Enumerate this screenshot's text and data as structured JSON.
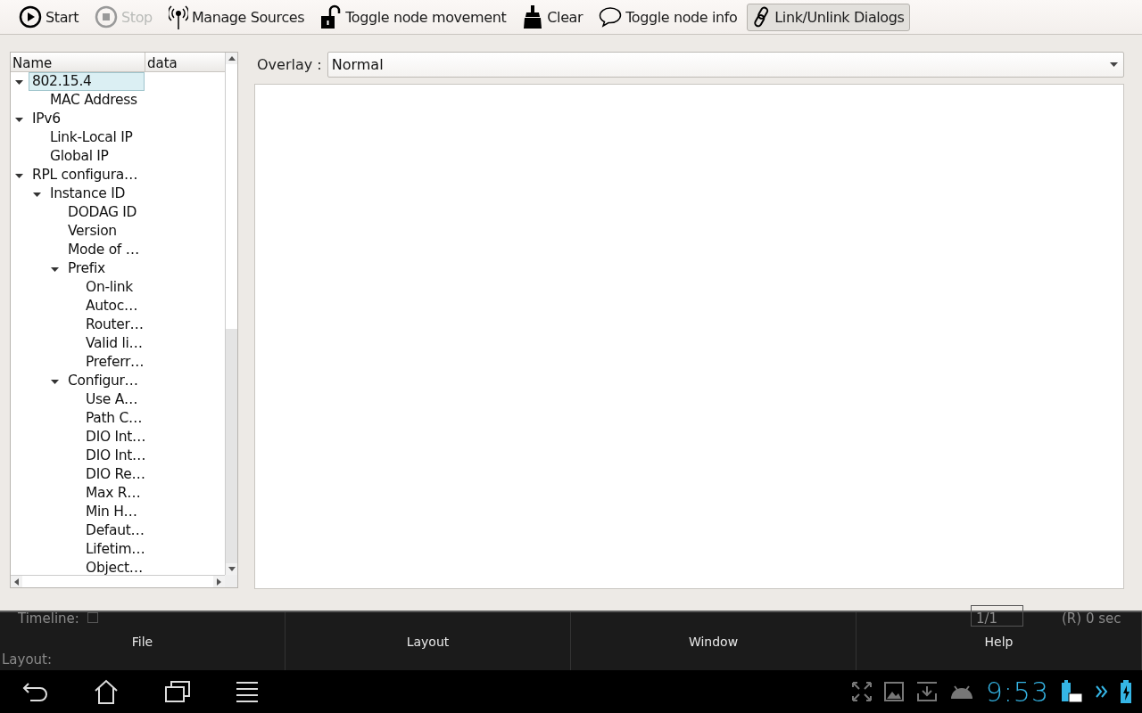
{
  "toolbar": [
    {
      "label": "Start",
      "disabled": false,
      "selected": false
    },
    {
      "label": "Stop",
      "disabled": true,
      "selected": false
    },
    {
      "label": "Manage Sources",
      "disabled": false,
      "selected": false
    },
    {
      "label": "Toggle node movement",
      "disabled": false,
      "selected": false
    },
    {
      "label": "Clear",
      "disabled": false,
      "selected": false
    },
    {
      "label": "Toggle node info",
      "disabled": false,
      "selected": false
    },
    {
      "label": "Link/Unlink Dialogs",
      "disabled": false,
      "selected": true
    }
  ],
  "tree": {
    "columns": [
      "Name",
      "data"
    ],
    "items": [
      {
        "label": "802.15.4",
        "selected": true,
        "expanded": true,
        "children": [
          {
            "label": "MAC Address",
            "selected": false
          }
        ]
      },
      {
        "label": "IPv6",
        "selected": false,
        "expanded": true,
        "children": [
          {
            "label": "Link-Local IP",
            "selected": false
          },
          {
            "label": "Global IP",
            "selected": false
          }
        ]
      },
      {
        "label": "RPL configura…",
        "selected": false,
        "expanded": true,
        "children": [
          {
            "label": "Instance ID",
            "selected": false,
            "expanded": true,
            "children": [
              {
                "label": "DODAG ID",
                "selected": false
              },
              {
                "label": "Version",
                "selected": false
              },
              {
                "label": "Mode of …",
                "selected": false
              },
              {
                "label": "Prefix",
                "selected": false,
                "expanded": true,
                "children": [
                  {
                    "label": "On-link",
                    "selected": false
                  },
                  {
                    "label": "Autoc…",
                    "selected": false
                  },
                  {
                    "label": "Router…",
                    "selected": false
                  },
                  {
                    "label": "Valid li…",
                    "selected": false
                  },
                  {
                    "label": "Preferr…",
                    "selected": false
                  }
                ]
              },
              {
                "label": "Configur…",
                "selected": false,
                "expanded": true,
                "children": [
                  {
                    "label": "Use A…",
                    "selected": false
                  },
                  {
                    "label": "Path C…",
                    "selected": false
                  },
                  {
                    "label": "DIO Int…",
                    "selected": false
                  },
                  {
                    "label": "DIO Int…",
                    "selected": false
                  },
                  {
                    "label": "DIO Re…",
                    "selected": false
                  },
                  {
                    "label": "Max R…",
                    "selected": false
                  },
                  {
                    "label": "Min H…",
                    "selected": false
                  },
                  {
                    "label": "Defaut…",
                    "selected": false
                  },
                  {
                    "label": "Lifetim…",
                    "selected": false
                  },
                  {
                    "label": "Object…",
                    "selected": false
                  }
                ]
              }
            ]
          }
        ]
      }
    ]
  },
  "overlay": {
    "label": "Overlay :",
    "value": "Normal"
  },
  "timeline": {
    "label": "Timeline:",
    "checked": false
  },
  "page_counter": "1/1",
  "elapsed": "(R) 0 sec",
  "layout_label": "Layout:",
  "menu": [
    {
      "label": "File"
    },
    {
      "label": "Layout"
    },
    {
      "label": "Window"
    },
    {
      "label": "Help"
    }
  ],
  "status_bar": {
    "time": "9:53"
  }
}
